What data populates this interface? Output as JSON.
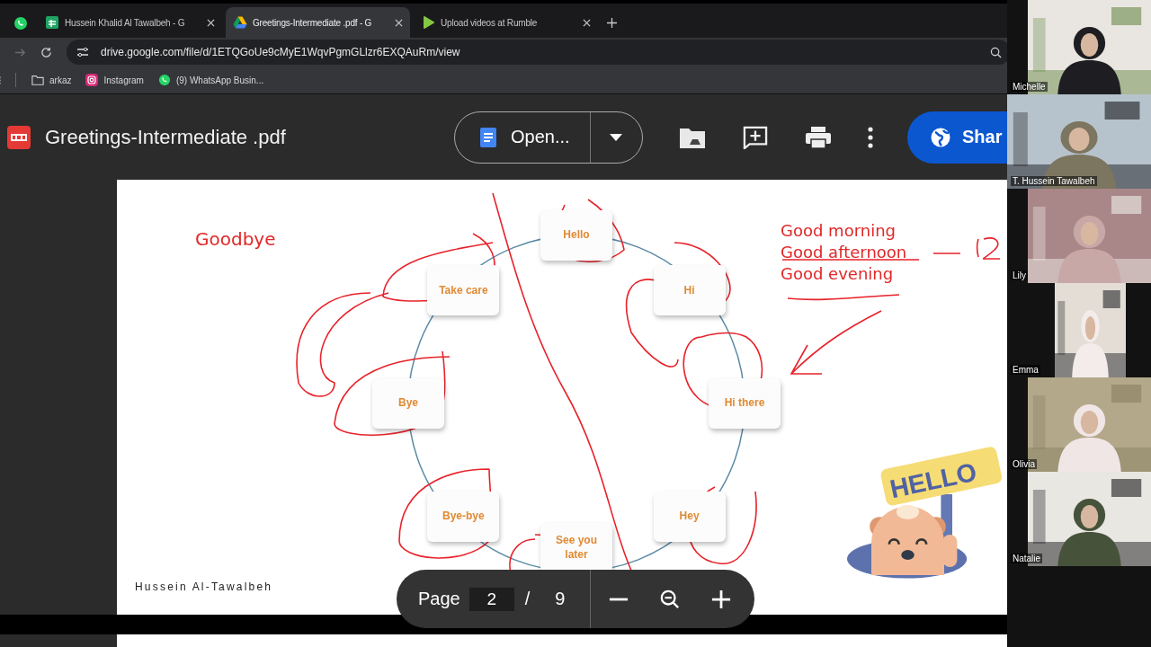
{
  "browser": {
    "tabs": [
      {
        "kind": "sheets",
        "title": "Hussein Khalid Al Tawalbeh - G",
        "selected": false
      },
      {
        "kind": "drive",
        "title": "Greetings-Intermediate .pdf - G",
        "selected": true
      },
      {
        "kind": "rumble",
        "title": "Upload videos at Rumble",
        "selected": false
      }
    ],
    "address_bar": {
      "url": "drive.google.com/file/d/1ETQGoUe9cMyE1WqvPgmGLlzr6EXQAuRm/view"
    },
    "bookmarks": [
      {
        "kind": "folder",
        "label": "arkaz"
      },
      {
        "kind": "instagram",
        "label": "Instagram"
      },
      {
        "kind": "whatsapp",
        "label": "(9) WhatsApp Busin..."
      }
    ]
  },
  "viewer": {
    "file_title": "Greetings-Intermediate .pdf",
    "open_button": "Open...",
    "share_button": "Shar"
  },
  "slide": {
    "nodes": [
      "Hello",
      "Hi",
      "Hi there",
      "Hey",
      "See you later",
      "Bye-bye",
      "Bye",
      "Take care"
    ],
    "annotation_left": "Goodbye",
    "annotation_right": [
      "Good morning",
      "Good afternoon",
      "Good evening"
    ],
    "footer": "Hussein Al-Tawalbeh",
    "sign_text": "HELLO"
  },
  "page_controls": {
    "label": "Page",
    "current": "2",
    "separator": "/",
    "total": "9"
  },
  "participants": [
    {
      "name": "Michelle"
    },
    {
      "name": "T. Hussein Tawalbeh"
    },
    {
      "name": "Lily"
    },
    {
      "name": "Emma"
    },
    {
      "name": "Olivia"
    },
    {
      "name": "Natalie"
    }
  ]
}
